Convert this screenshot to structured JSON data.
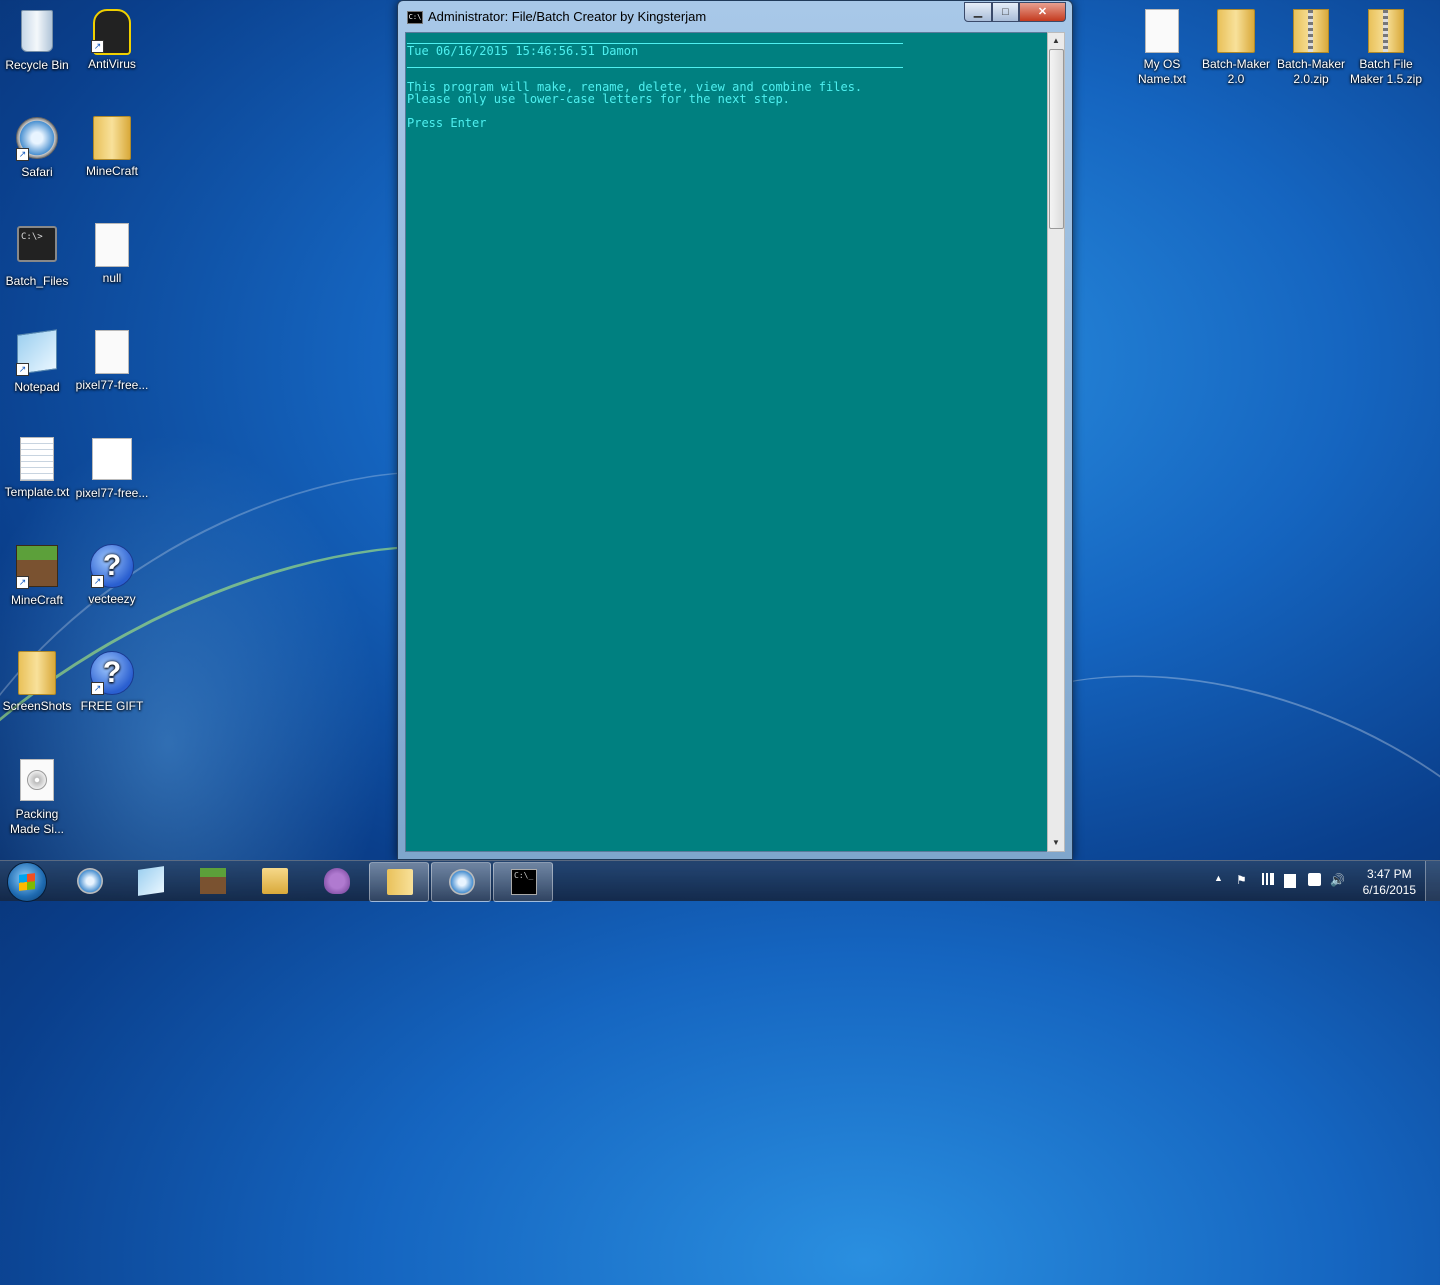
{
  "desktop": {
    "left_icons": [
      {
        "label": "Recycle Bin",
        "icon": "recycle-bin-icon"
      },
      {
        "label": "AntiVirus",
        "icon": "antivirus-icon"
      },
      {
        "label": "Safari",
        "icon": "safari-icon"
      },
      {
        "label": "MineCraft",
        "icon": "folder-icon"
      },
      {
        "label": "Batch_Files",
        "icon": "cmd-icon"
      },
      {
        "label": "null",
        "icon": "file-icon"
      },
      {
        "label": "Notepad",
        "icon": "notepad-icon"
      },
      {
        "label": "pixel77-free...",
        "icon": "file-icon"
      },
      {
        "label": "Template.txt",
        "icon": "text-file-icon"
      },
      {
        "label": "pixel77-free...",
        "icon": "paint-file-icon"
      },
      {
        "label": "MineCraft",
        "icon": "minecraft-icon"
      },
      {
        "label": "vecteezy",
        "icon": "help-icon"
      },
      {
        "label": "ScreenShots",
        "icon": "folder-icon"
      },
      {
        "label": "FREE GIFT",
        "icon": "help-icon"
      },
      {
        "label": "Packing Made Si...",
        "icon": "disc-file-icon"
      }
    ],
    "right_icons": [
      {
        "label": "My OS Name.txt",
        "icon": "file-icon"
      },
      {
        "label": "Batch-Maker 2.0",
        "icon": "folder-icon"
      },
      {
        "label": "Batch-Maker 2.0.zip",
        "icon": "zip-folder-icon"
      },
      {
        "label": "Batch File Maker 1.5.zip",
        "icon": "zip-folder-icon"
      }
    ]
  },
  "window": {
    "title": "Administrator:  File/Batch Creator by Kingsterjam",
    "buttons": {
      "minimize": "▁",
      "maximize": "□",
      "close": "✕"
    },
    "console_lines": {
      "datetime": "Tue 06/16/2015 15:46:56.51 Damon",
      "line1": "This program will make, rename, delete, view and combine files.",
      "line2": "Please only use lower-case letters for the next step.",
      "prompt": "Press Enter"
    },
    "scroll": {
      "up": "▲",
      "down": "▼"
    }
  },
  "taskbar": {
    "pinned": [
      "safari-icon",
      "notepad-icon",
      "minecraft-icon",
      "explorer-icon",
      "pidgin-icon",
      "folder-icon",
      "safari-icon",
      "cmd-icon"
    ],
    "cmd_glyph": "C:\\_",
    "tray": {
      "arrow": "▲",
      "flag": "⚑",
      "volume": "🔊"
    },
    "clock": {
      "time": "3:47 PM",
      "date": "6/16/2015"
    }
  },
  "colors": {
    "console_bg": "#008080",
    "console_text": "#4ef0f0",
    "taskbar": "#1c3a60"
  }
}
